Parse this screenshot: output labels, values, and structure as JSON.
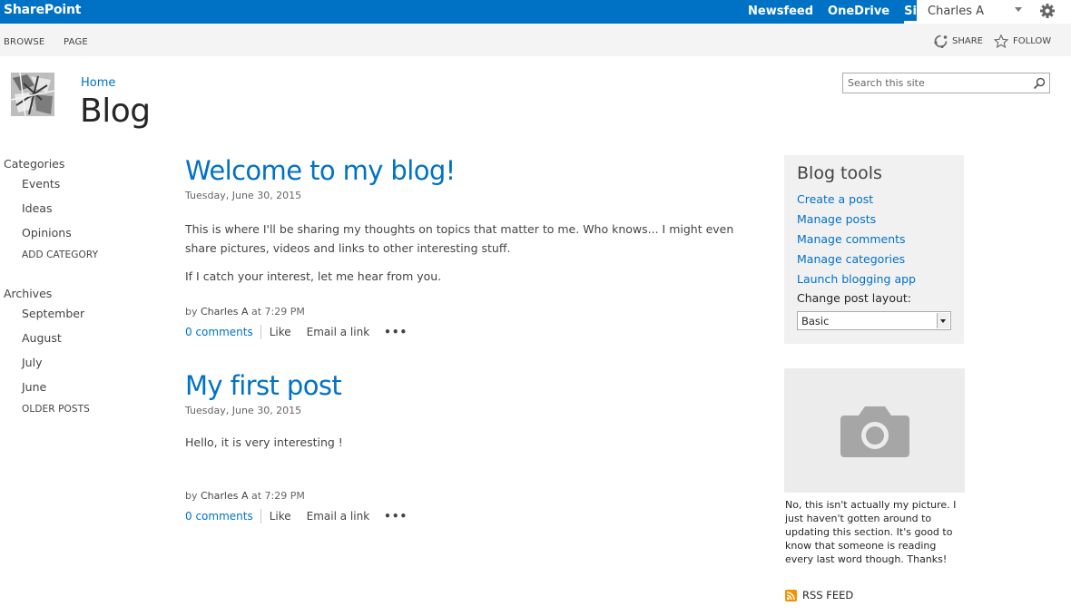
{
  "suite_bar": {
    "brand": "SharePoint",
    "links": [
      "Newsfeed",
      "OneDrive",
      "Sites"
    ],
    "active_link": "Sites",
    "user_name": "Charles A",
    "accent_color": "#0072c6"
  },
  "ribbon": {
    "tabs": [
      "BROWSE",
      "PAGE"
    ],
    "share_label": "SHARE",
    "follow_label": "FOLLOW"
  },
  "header": {
    "breadcrumb": "Home",
    "title": "Blog",
    "search_placeholder": "Search this site"
  },
  "left_nav": {
    "categories_heading": "Categories",
    "categories": [
      "Events",
      "Ideas",
      "Opinions"
    ],
    "add_category": "ADD CATEGORY",
    "archives_heading": "Archives",
    "archives": [
      "September",
      "August",
      "July",
      "June"
    ],
    "older_posts": "OLDER POSTS"
  },
  "posts": [
    {
      "title": "Welcome to my blog!",
      "date": "Tuesday, June 30, 2015",
      "paragraphs": [
        "This is where I'll be sharing my thoughts on topics that matter to me. Who knows... I might even share pictures, videos and links to other interesting stuff.",
        "If I catch your interest, let me hear from you."
      ],
      "byline_prefix": "by",
      "author": "Charles A",
      "time": "at 7:29 PM",
      "comments": "0 comments",
      "like": "Like",
      "email": "Email a link",
      "more": "•••"
    },
    {
      "title": "My first post",
      "date": "Tuesday, June 30, 2015",
      "paragraphs": [
        "Hello, it is very interesting !"
      ],
      "byline_prefix": "by",
      "author": "Charles A",
      "time": "at 7:29 PM",
      "comments": "0 comments",
      "like": "Like",
      "email": "Email a link",
      "more": "•••"
    }
  ],
  "blog_tools": {
    "title": "Blog tools",
    "links": [
      "Create a post",
      "Manage posts",
      "Manage comments",
      "Manage categories",
      "Launch blogging app"
    ],
    "layout_label": "Change post layout:",
    "layout_value": "Basic"
  },
  "about": {
    "text": "No, this isn't actually my picture. I just haven't gotten around to updating this section. It's good to know that someone is reading every last word though. Thanks!"
  },
  "rss_label": "RSS FEED"
}
